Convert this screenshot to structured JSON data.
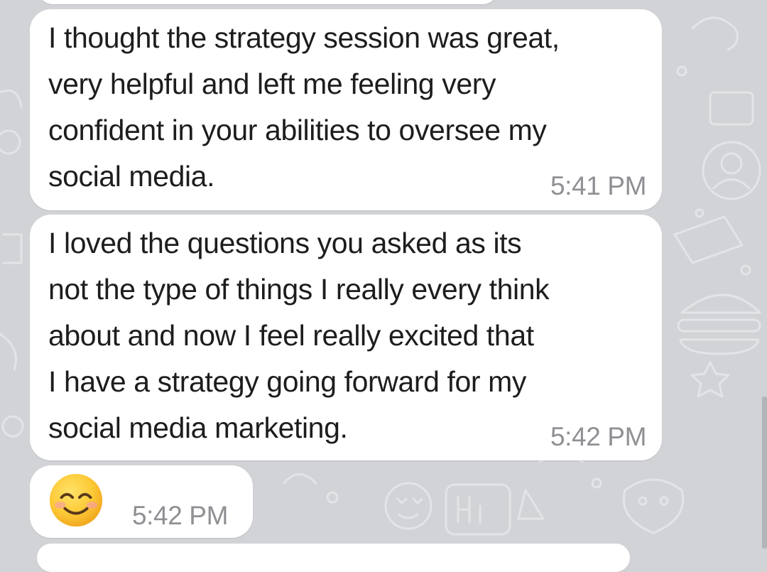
{
  "chat": {
    "messages": [
      {
        "text": "I thought the strategy session was great,\nvery helpful and left me feeling very\nconfident in your abilities to oversee my\nsocial media.",
        "time": "5:41 PM"
      },
      {
        "text": "I loved the questions you asked as its\nnot the type of things I really every think\nabout and now I feel really excited that\nI have a strategy going forward for my\nsocial media marketing.",
        "time": "5:42 PM"
      },
      {
        "emoji": "smiling-face-with-smiling-eyes",
        "time": "5:42 PM"
      }
    ]
  },
  "colors": {
    "background": "#d2d3d6",
    "bubble": "#ffffff",
    "text": "#1d1d1f",
    "timestamp": "#8f8f94"
  }
}
